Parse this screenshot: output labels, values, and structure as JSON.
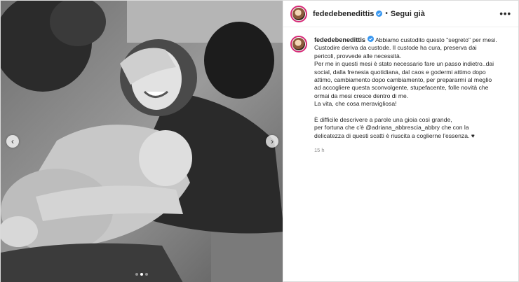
{
  "header": {
    "username": "fededebenedittis",
    "separator": "•",
    "follow_label": "Segui già",
    "more_label": "•••"
  },
  "caption": {
    "username": "fededebenedittis",
    "first_line": "Abbiamo custodito questo \"segreto\" per mesi.",
    "lines": [
      "Custodire deriva da custode. Il custode ha cura, preserva dai",
      "pericoli, provvede alle necessità.",
      "Per me in questi mesi è stato necessario fare un passo indietro..dai",
      "social, dalla frenesia quotidiana, dal caos e godermi attimo dopo",
      "attimo, cambiamento dopo cambiamento, per prepararmi al meglio",
      "ad accogliere questa sconvolgente, stupefacente, folle novità che",
      "ormai da mesi cresce dentro di me.",
      "La vita, che cosa meravigliosa!"
    ],
    "lines2": [
      "È difficile descrivere a parole una gioia così grande,",
      "per fortuna che c'è @adriana_abbrescia_abbry che con la",
      "delicatezza di questi scatti è riuscita a coglierne l'essenza. ♥"
    ],
    "time": "15 h"
  },
  "carousel": {
    "prev_icon": "chevron-left-icon",
    "next_icon": "chevron-right-icon",
    "slide_count": 3,
    "active_slide": 2
  },
  "colors": {
    "verified": "#3897f0",
    "story_ring": "#d62976",
    "muted": "#8e8e8e"
  }
}
